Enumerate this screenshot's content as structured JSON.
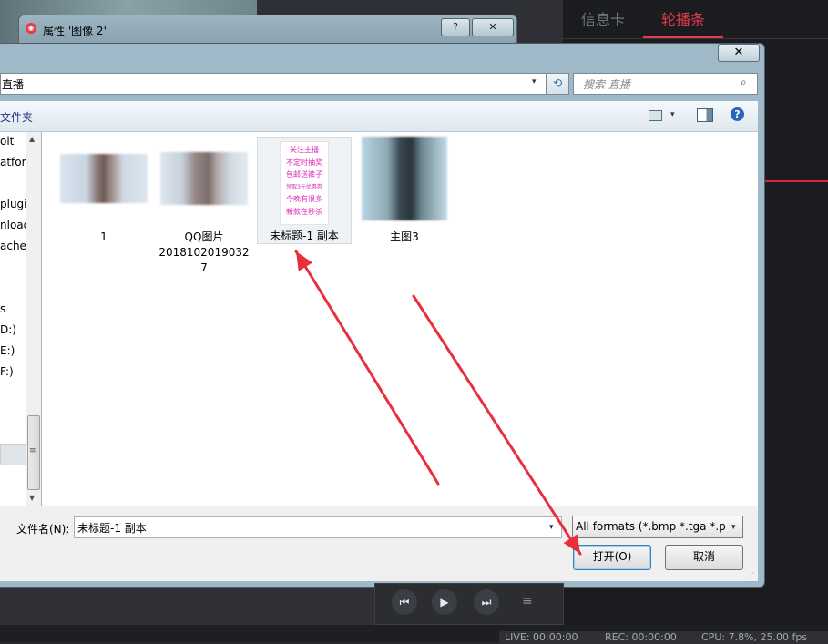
{
  "background": {
    "right_panel": {
      "tabs": [
        {
          "label": "信息卡",
          "active": false
        },
        {
          "label": "轮播条",
          "active": true
        }
      ],
      "accent_color": "#e83a4e"
    },
    "properties_dialog": {
      "title": "属性 '图像 2'",
      "help_button": "?",
      "close_button": "✕"
    },
    "player": {
      "prev_icon": "⏮",
      "play_icon": "▶",
      "next_icon": "⏭",
      "menu_icon": "≡"
    },
    "status": {
      "live": "LIVE: 00:00:00",
      "rec": "REC: 00:00:00",
      "cpu": "CPU: 7.8%, 25.00 fps"
    }
  },
  "open_dialog": {
    "close_button": "✕",
    "address": {
      "path": "直播",
      "dropdown": "▾",
      "refresh_icon": "⟲"
    },
    "search": {
      "placeholder": "搜索 直播",
      "icon": "⌕"
    },
    "toolbar": {
      "new_folder_label": "文件夹",
      "view_dropdown": "▾",
      "help_icon": "?"
    },
    "nav_pane": {
      "items": [
        "oit",
        "atfor",
        "plugi",
        "nload",
        "ache",
        "s",
        "D:)",
        "E:)",
        "F:)"
      ],
      "grip": "≡",
      "scroll_up": "▲",
      "scroll_down": "▼"
    },
    "files": [
      {
        "name": "1",
        "selected": false
      },
      {
        "name": "QQ图片20181020190327",
        "selected": false
      },
      {
        "name": "未标题-1 副本",
        "selected": true,
        "thumb_lines": [
          "关注主播",
          "不定时抽奖",
          "包邮送裤子",
          "领取3元优惠券",
          "今晚有很多",
          "新款在秒杀"
        ]
      },
      {
        "name": "主图3",
        "selected": false
      }
    ],
    "filename": {
      "label": "文件名(N):",
      "value": "未标题-1 副本",
      "dropdown": "▾"
    },
    "filter": {
      "value": "All formats (*.bmp *.tga *.pn",
      "dropdown": "▾"
    },
    "buttons": {
      "open": "打开(O)",
      "cancel": "取消"
    },
    "resize_grip": "⋰"
  },
  "annotation_color": "#e8303c"
}
